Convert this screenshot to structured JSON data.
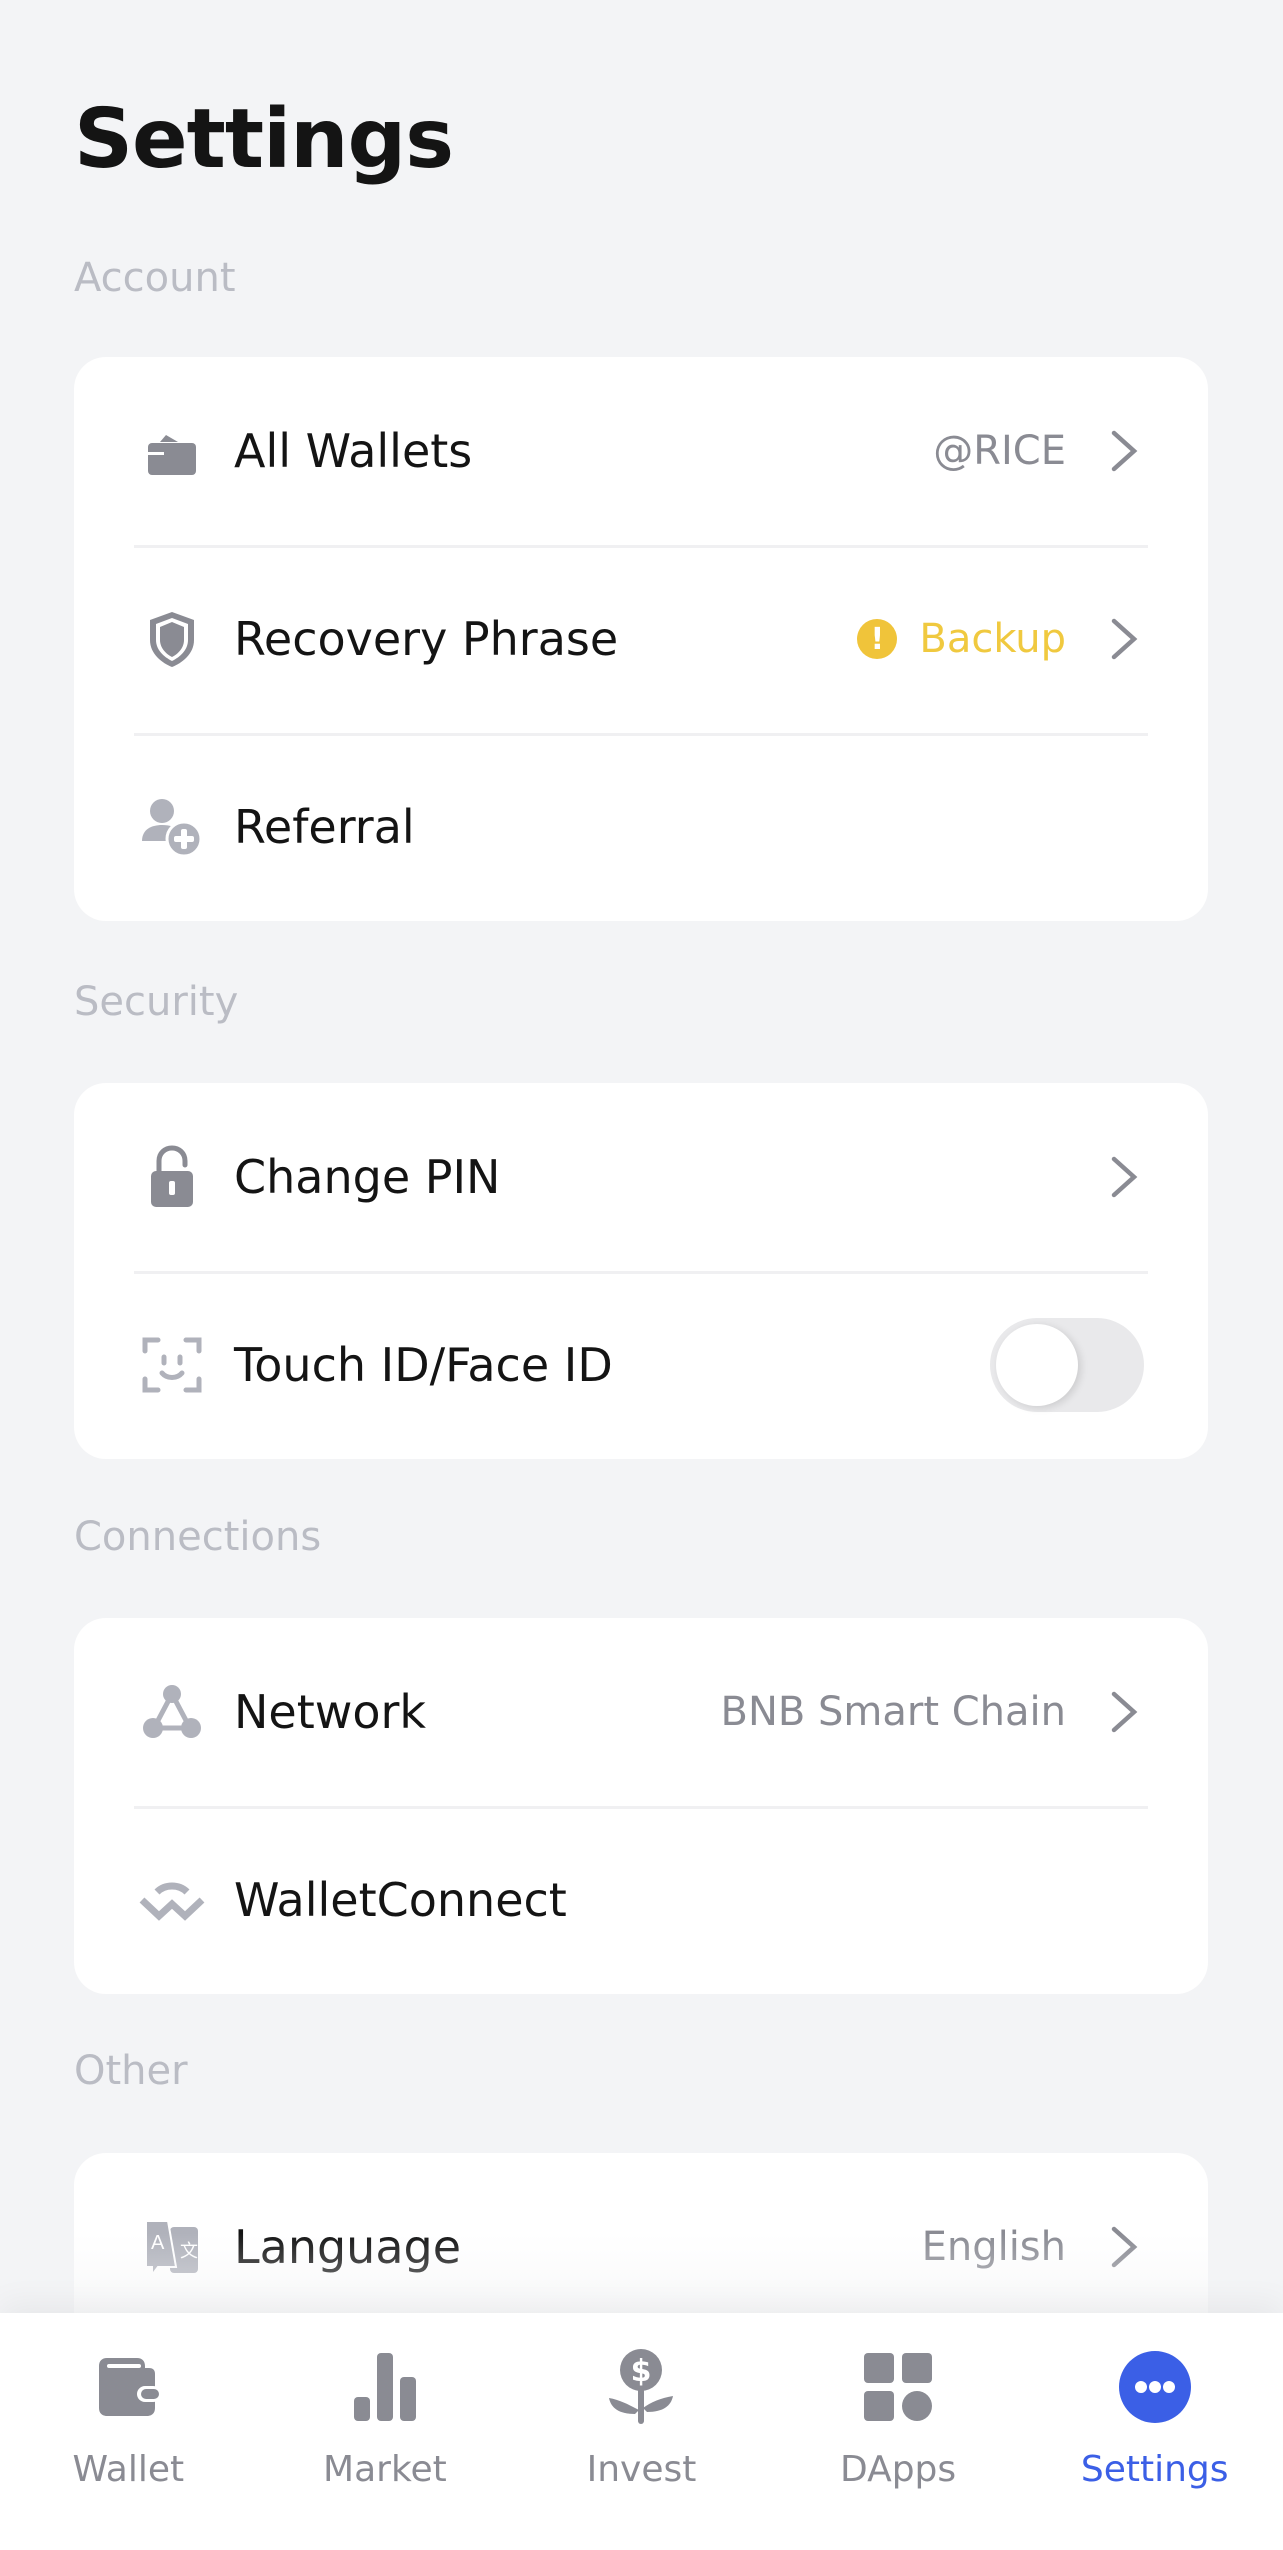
{
  "header": {
    "title": "Settings"
  },
  "sections": {
    "account": {
      "label": "Account",
      "items": [
        {
          "label": "All Wallets",
          "value": "@RICE",
          "icon": "wallet-icon",
          "chevron": true
        },
        {
          "label": "Recovery Phrase",
          "value": "Backup",
          "value_status": "warning",
          "icon": "shield-icon",
          "chevron": true
        },
        {
          "label": "Referral",
          "icon": "add-user-icon",
          "chevron": false
        }
      ]
    },
    "security": {
      "label": "Security",
      "items": [
        {
          "label": "Change PIN",
          "icon": "lock-icon",
          "chevron": true
        },
        {
          "label": "Touch ID/Face ID",
          "icon": "face-id-icon",
          "toggle": false
        }
      ]
    },
    "connections": {
      "label": "Connections",
      "items": [
        {
          "label": "Network",
          "value": "BNB Smart Chain",
          "icon": "network-icon",
          "chevron": true
        },
        {
          "label": "WalletConnect",
          "icon": "walletconnect-icon",
          "chevron": false
        }
      ]
    },
    "other": {
      "label": "Other",
      "items": [
        {
          "label": "Language",
          "value": "English",
          "icon": "translate-icon",
          "chevron": true
        }
      ]
    }
  },
  "bottom_nav": {
    "items": [
      {
        "label": "Wallet",
        "icon": "wallet-icon",
        "active": false
      },
      {
        "label": "Market",
        "icon": "bar-chart-icon",
        "active": false
      },
      {
        "label": "Invest",
        "icon": "money-plant-icon",
        "active": false
      },
      {
        "label": "DApps",
        "icon": "apps-grid-icon",
        "active": false
      },
      {
        "label": "Settings",
        "icon": "more-dots-icon",
        "active": true
      }
    ]
  },
  "colors": {
    "accent": "#3b5fe6",
    "warning": "#f0c43a",
    "background": "#f3f4f6",
    "icon_gray": "#8a8b93",
    "icon_light": "#b0b2bb"
  }
}
